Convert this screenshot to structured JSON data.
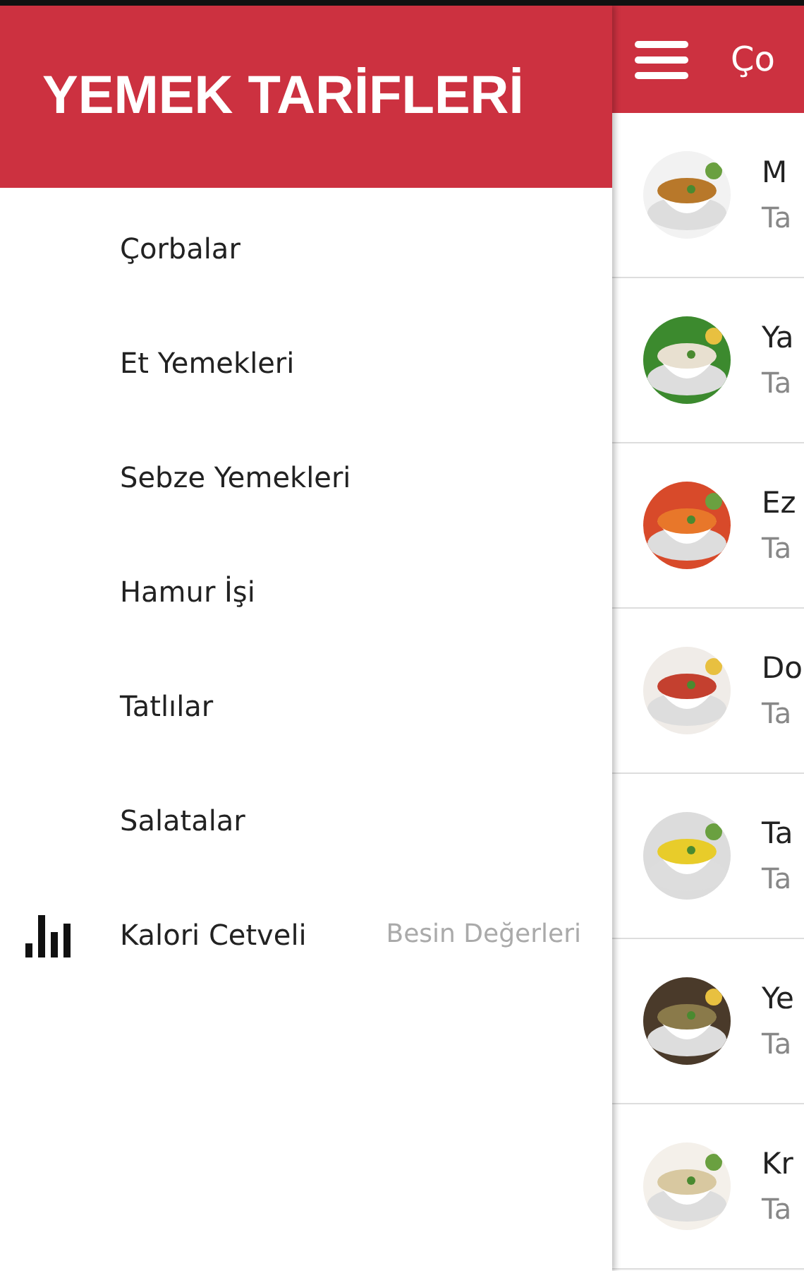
{
  "drawer": {
    "title": "YEMEK TARİFLERİ",
    "items": [
      {
        "label": "Çorbalar",
        "kind": "plain"
      },
      {
        "label": "Et Yemekleri",
        "kind": "plain"
      },
      {
        "label": "Sebze Yemekleri",
        "kind": "plain"
      },
      {
        "label": "Hamur İşi",
        "kind": "plain"
      },
      {
        "label": "Tatlılar",
        "kind": "plain"
      },
      {
        "label": "Salatalar",
        "kind": "plain"
      },
      {
        "label": "Kalori Cetveli",
        "kind": "chart",
        "secondary": "Besin Değerleri"
      }
    ]
  },
  "main": {
    "title": "Ço",
    "recipes": [
      {
        "title": "M",
        "subtitle": "Ta"
      },
      {
        "title": "Ya",
        "subtitle": "Ta"
      },
      {
        "title": "Ez",
        "subtitle": "Ta"
      },
      {
        "title": "Do",
        "subtitle": "Ta"
      },
      {
        "title": "Ta",
        "subtitle": "Ta"
      },
      {
        "title": "Ye",
        "subtitle": "Ta"
      },
      {
        "title": "Kr",
        "subtitle": "Ta"
      }
    ]
  }
}
